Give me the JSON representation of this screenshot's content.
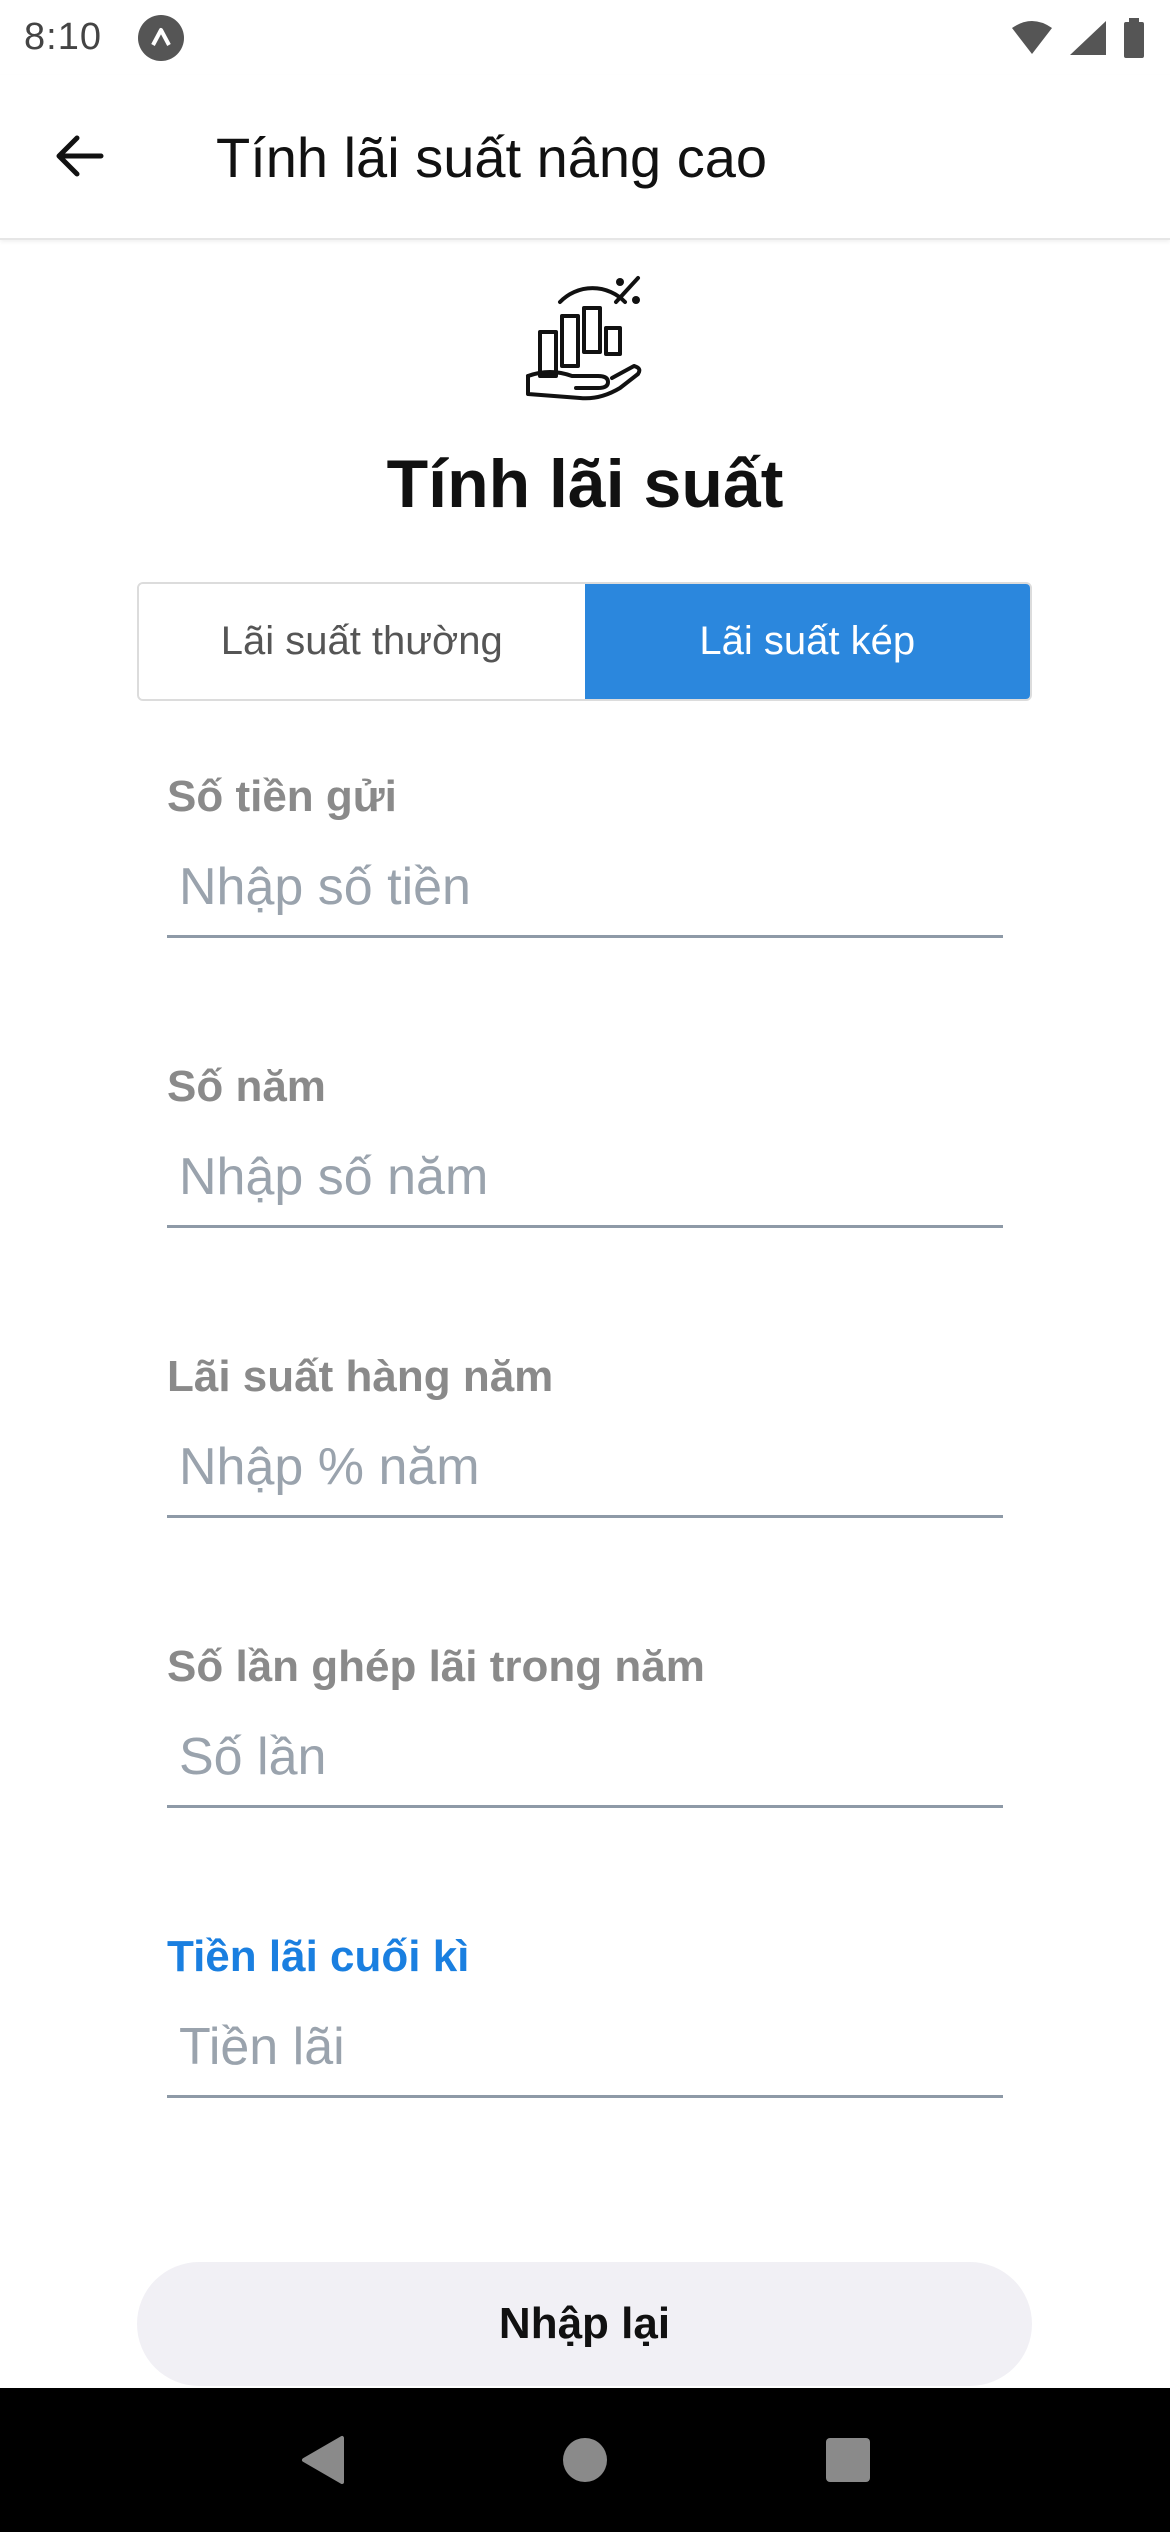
{
  "status_bar": {
    "time": "8:10",
    "icons": [
      "app-notification-icon",
      "wifi-icon",
      "cellular-signal-icon",
      "battery-icon"
    ]
  },
  "app_bar": {
    "back_icon": "arrow-left-icon",
    "title": "Tính lãi suất nâng cao"
  },
  "hero": {
    "icon": "interest-chart-hand-icon",
    "title": "Tính lãi suất"
  },
  "segmented": {
    "options": [
      {
        "label": "Lãi suất thường",
        "selected": false
      },
      {
        "label": "Lãi suất kép",
        "selected": true
      }
    ],
    "active_color": "#2b87dd"
  },
  "fields": [
    {
      "label": "Số tiền gửi",
      "placeholder": "Nhập số tiền",
      "value": ""
    },
    {
      "label": "Số năm",
      "placeholder": "Nhập số năm",
      "value": ""
    },
    {
      "label": "Lãi suất hàng năm",
      "placeholder": "Nhập % năm",
      "value": ""
    },
    {
      "label": "Số lần ghép lãi trong năm",
      "placeholder": "Số lần",
      "value": ""
    },
    {
      "label": "Tiền lãi cuối kì",
      "placeholder": "Tiền lãi",
      "value": ""
    }
  ],
  "result_label_color": "#1a7fe0",
  "reset_button": {
    "label": "Nhập lại"
  },
  "nav_bar": {
    "icons": [
      "nav-back-icon",
      "nav-home-icon",
      "nav-recents-icon"
    ]
  }
}
